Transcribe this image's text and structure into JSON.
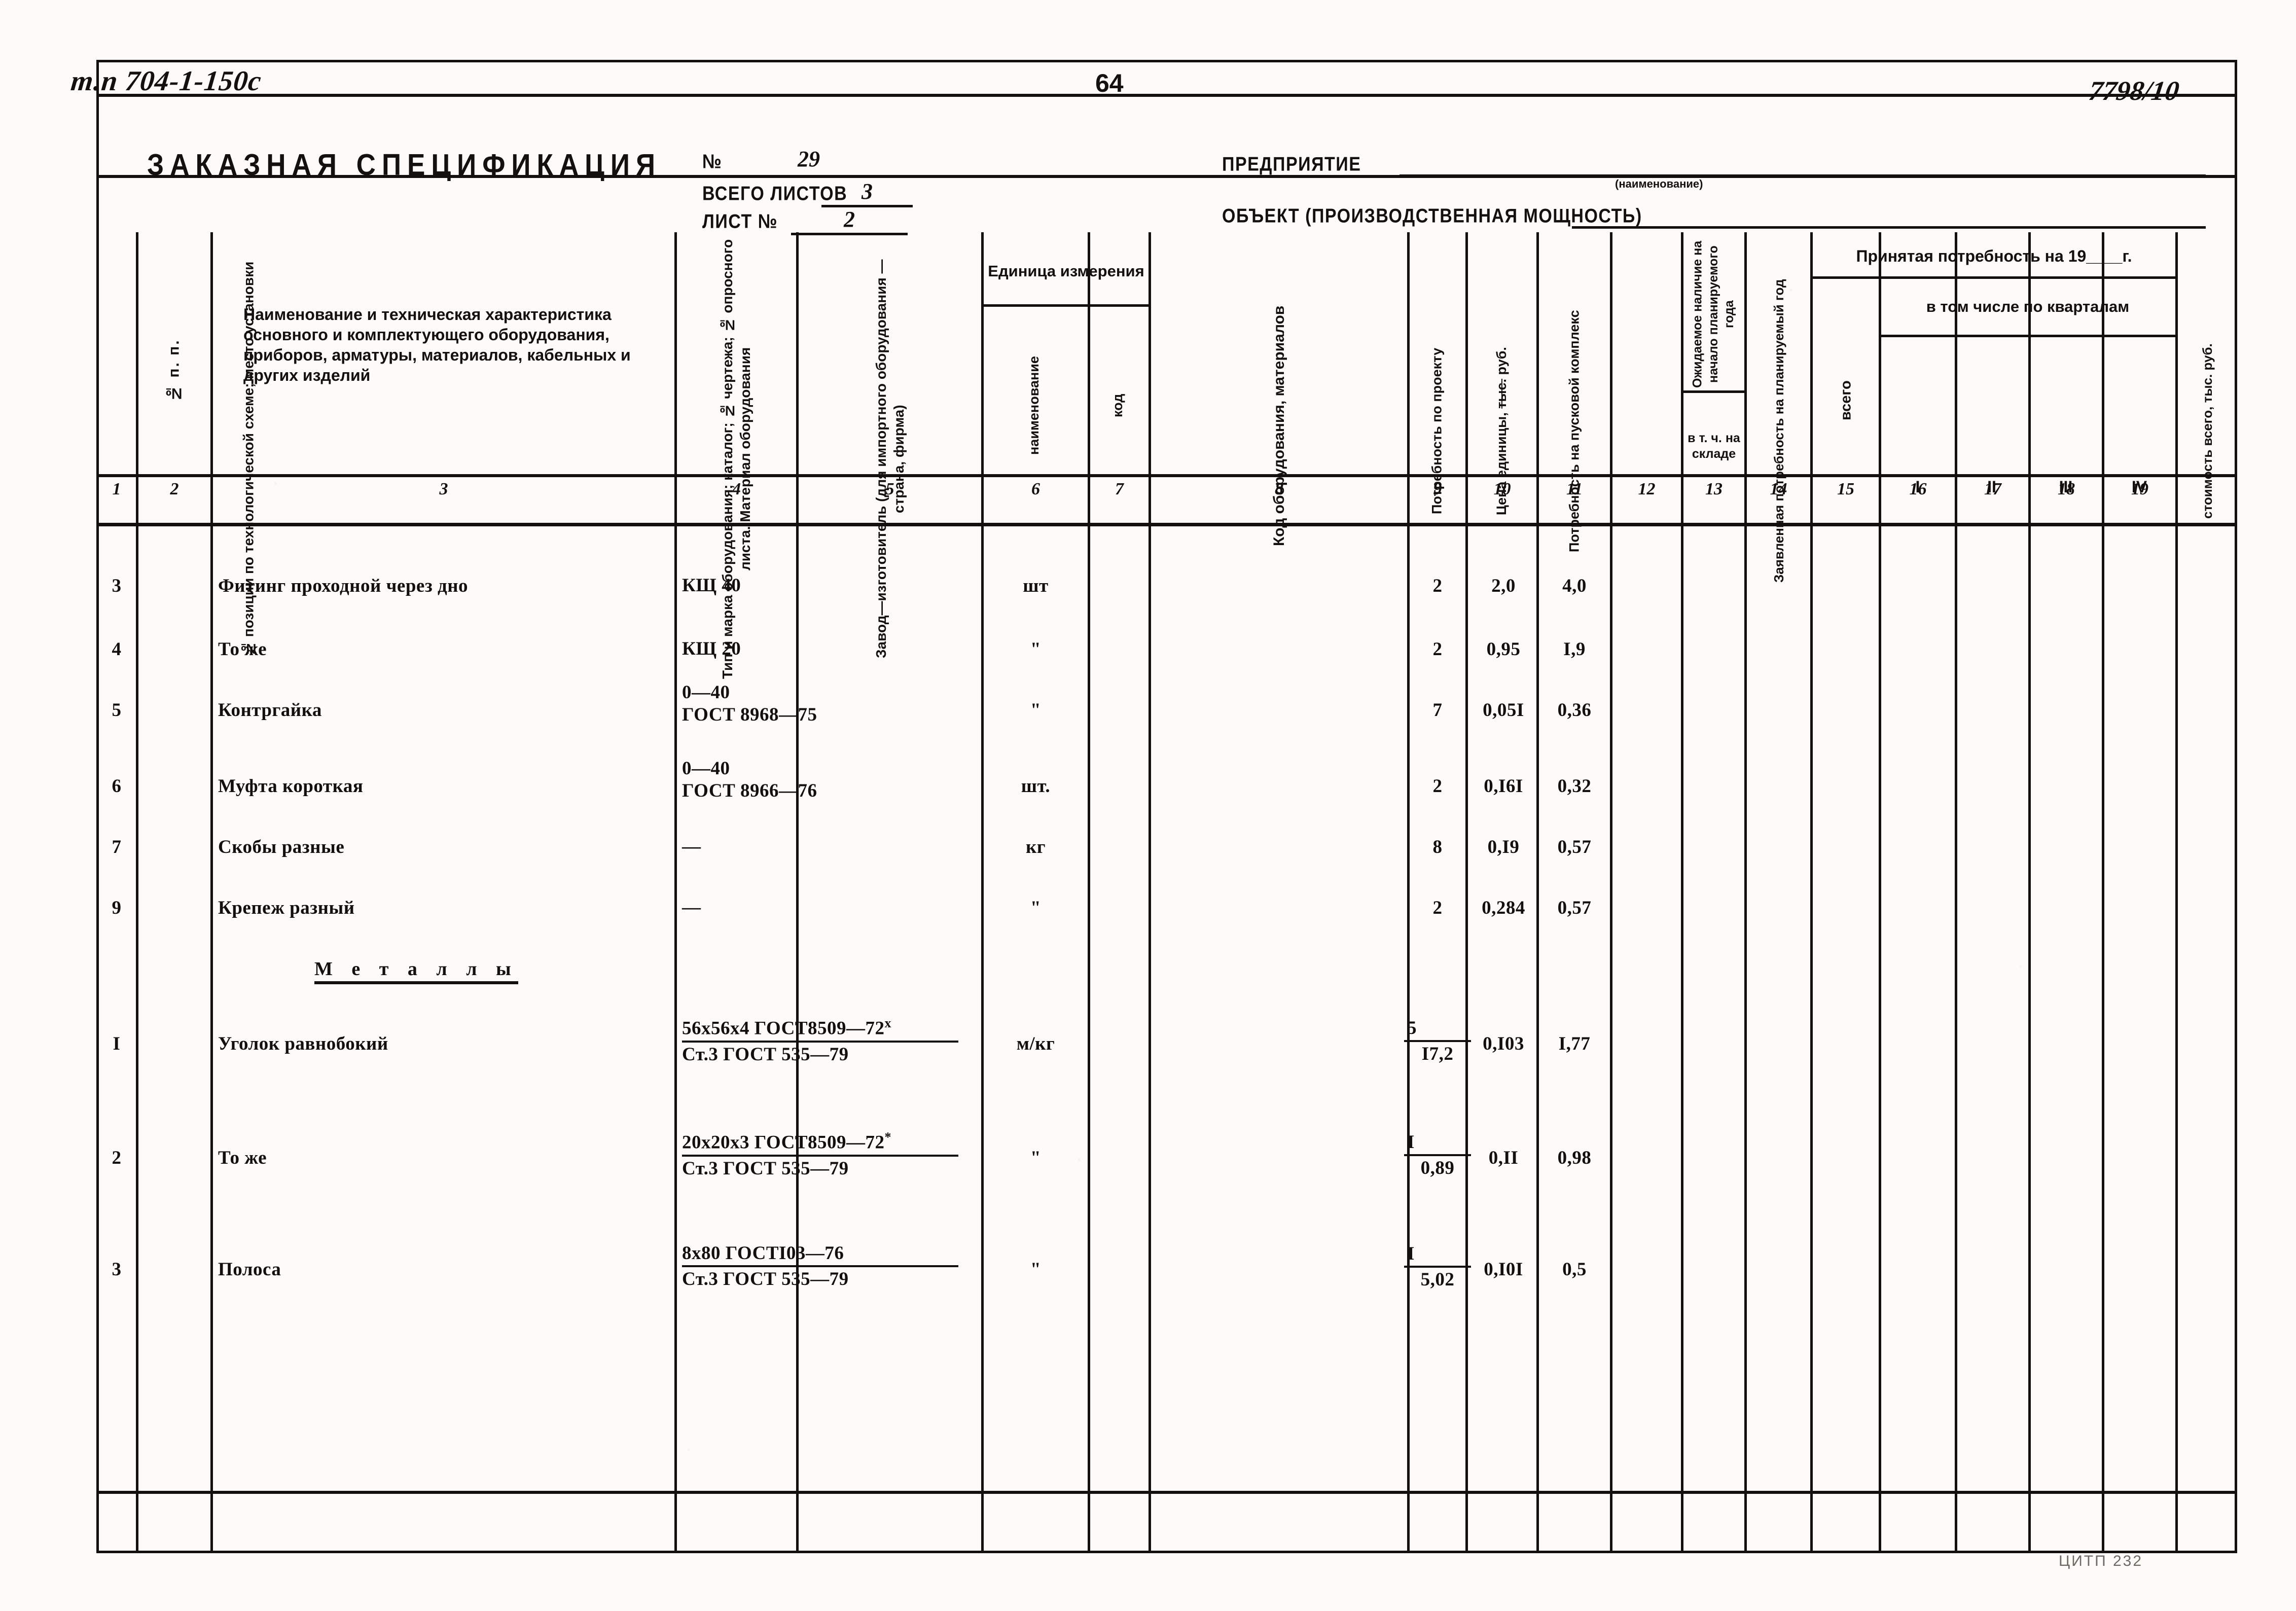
{
  "document": {
    "sheet_code": "т.п 704-1-150с",
    "page_number": "64",
    "doc_number": "7798/10",
    "footer": "ЦИТП    232"
  },
  "header": {
    "title": "ЗАКАЗНАЯ СПЕЦИФИКАЦИЯ",
    "number_label": "№",
    "number_value": "29",
    "total_sheets_label": "ВСЕГО ЛИСТОВ",
    "total_sheets_value": "3",
    "sheet_label": "ЛИСТ №",
    "sheet_value": "2",
    "enterprise_label": "ПРЕДПРИЯТИЕ",
    "enterprise_value": "",
    "enterprise_hint": "(наименование)",
    "object_label": "ОБЪЕКТ (ПРОИЗВОДСТВЕННАЯ МОЩНОСТЬ)",
    "object_value": ""
  },
  "table": {
    "headers": {
      "c1": "№ п. п.",
      "c2": "№ позиции по технологической схеме; место установки",
      "c3": "Наименование и техническая характеристика основного и комплектующего оборудования, приборов, арматуры, материалов, кабельных и других изделий",
      "c4": "Тип и марка оборудования; каталог; № чертежа; № опросного листа. Материал оборудования",
      "c5": "Завод—изготовитель (для импортного оборудования —страна, фирма)",
      "c6_group": "Единица измерения",
      "c6": "наименование",
      "c7": "код",
      "c8": "Код оборудования, материалов",
      "c9": "Потребность по проекту",
      "c10": "Цена единицы, тыс. руб.",
      "c10_strike": "тыс.",
      "c11": "Потребность на пусковой комплекс",
      "c12": "Ожидаемое наличие на начало планируемого года",
      "c12_sub": "в т. ч. на складе",
      "c13": "Заявленная потребность на планируемый год",
      "c14_group": "Принятая потребность на 19____г.",
      "c14": "всего",
      "c15_group": "в том числе по кварталам",
      "c15": "I",
      "c16": "II",
      "c17": "III",
      "c18": "IV",
      "c19": "стоимость всего, тыс. руб."
    },
    "column_numbers": [
      "1",
      "2",
      "3",
      "4",
      "5",
      "6",
      "7",
      "8",
      "9",
      "10",
      "11",
      "12",
      "13",
      "14",
      "15",
      "16",
      "17",
      "18",
      "19"
    ],
    "rows": [
      {
        "no": "3",
        "name": "Фитинг проходной через дно",
        "type_top": "КЩ 40",
        "type_bottom": "",
        "unit": "шт",
        "qty": "2",
        "price": "2,0",
        "startup": "4,0"
      },
      {
        "no": "4",
        "name": "То же",
        "type_top": "КЩ 20",
        "type_bottom": "",
        "unit": "\"",
        "qty": "2",
        "price": "0,95",
        "startup": "I,9"
      },
      {
        "no": "5",
        "name": "Контргайка",
        "type_top": "0—40",
        "type_bottom": "ГОСТ 8968—75",
        "unit": "\"",
        "qty": "7",
        "price": "0,05I",
        "startup": "0,36"
      },
      {
        "no": "6",
        "name": "Муфта короткая",
        "type_top": "0—40",
        "type_bottom": "ГОСТ 8966—76",
        "unit": "шт.",
        "qty": "2",
        "price": "0,I6I",
        "startup": "0,32"
      },
      {
        "no": "7",
        "name": "Скобы разные",
        "type_top": "—",
        "type_bottom": "",
        "unit": "кг",
        "qty": "8",
        "price": "0,I9",
        "startup": "0,57"
      },
      {
        "no": "9",
        "name": "Крепеж разный",
        "type_top": "—",
        "type_bottom": "",
        "unit": "\"",
        "qty": "2",
        "price": "0,284",
        "startup": "0,57"
      }
    ],
    "section_title": "Металлы",
    "metal_rows": [
      {
        "no": "I",
        "name": "Уголок равнобокий",
        "type_top": "56х56х4  ГОСТ8509—72",
        "type_top_sup": "х",
        "type_bottom": "Ст.3 ГОСТ 535—79",
        "unit": "м/кг",
        "qty_num": "5",
        "qty_den": "I7,2",
        "price": "0,I03",
        "startup": "I,77"
      },
      {
        "no": "2",
        "name": "То же",
        "type_top": "20х20х3  ГОСТ8509—72",
        "type_top_sup": "*",
        "type_bottom": "Ст.3 ГОСТ 535—79",
        "unit": "\"",
        "qty_num": "I",
        "qty_den": "0,89",
        "price": "0,II",
        "startup": "0,98"
      },
      {
        "no": "3",
        "name": "Полоса",
        "type_top": "8х80 ГОСТI03—76",
        "type_top_sup": "",
        "type_bottom": "Ст.3 ГОСТ 535—79",
        "unit": "\"",
        "qty_num": "I",
        "qty_den": "5,02",
        "price": "0,I0I",
        "startup": "0,5"
      }
    ]
  }
}
